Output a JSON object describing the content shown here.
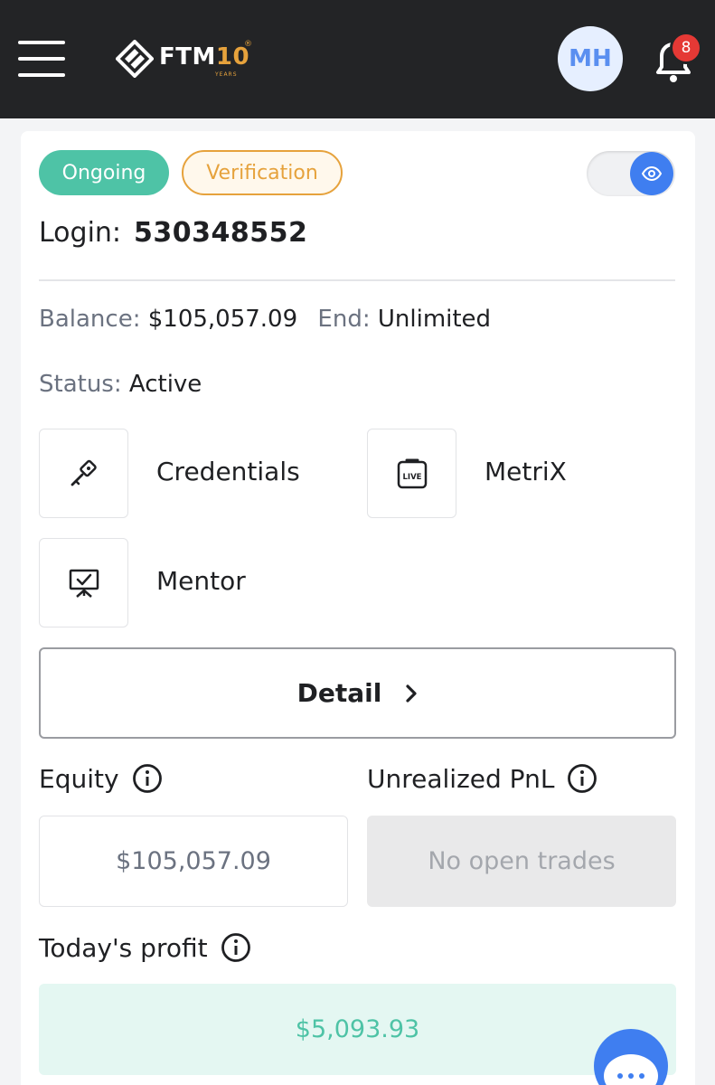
{
  "header": {
    "logo_text_a": "FTM",
    "logo_text_b": "10",
    "logo_sub": "YEARS",
    "logo_reg": "®",
    "avatar_initials": "MH",
    "notification_count": "8"
  },
  "account": {
    "badge_status": "Ongoing",
    "badge_phase": "Verification",
    "login_label": "Login:",
    "login_value": "530348552",
    "balance_label": "Balance:",
    "balance_value": "$105,057.09",
    "end_label": "End:",
    "end_value": "Unlimited",
    "status_label": "Status:",
    "status_value": "Active"
  },
  "tools": {
    "credentials": "Credentials",
    "metrix": "MetriX",
    "metrix_icon_text": "LIVE",
    "mentor": "Mentor"
  },
  "detail_button": "Detail",
  "equity": {
    "label": "Equity",
    "value": "$105,057.09"
  },
  "unrealized": {
    "label": "Unrealized PnL",
    "value": "No open trades"
  },
  "today_profit": {
    "label": "Today's profit",
    "value": "$5,093.93"
  },
  "colors": {
    "accent_blue": "#3f7ef0",
    "ongoing_green": "#4ec3a6",
    "verification_orange": "#e6a23c",
    "header_dark": "#232426",
    "notification_red": "#e53935"
  },
  "icons": {
    "menu": "hamburger-icon",
    "notifications": "bell-icon",
    "visibility": "eye-icon",
    "credentials": "key-icon",
    "metrix": "live-clipboard-icon",
    "mentor": "presentation-board-icon",
    "detail": "chevron-right-icon",
    "info": "info-icon",
    "chat": "chat-bubble-icon"
  }
}
